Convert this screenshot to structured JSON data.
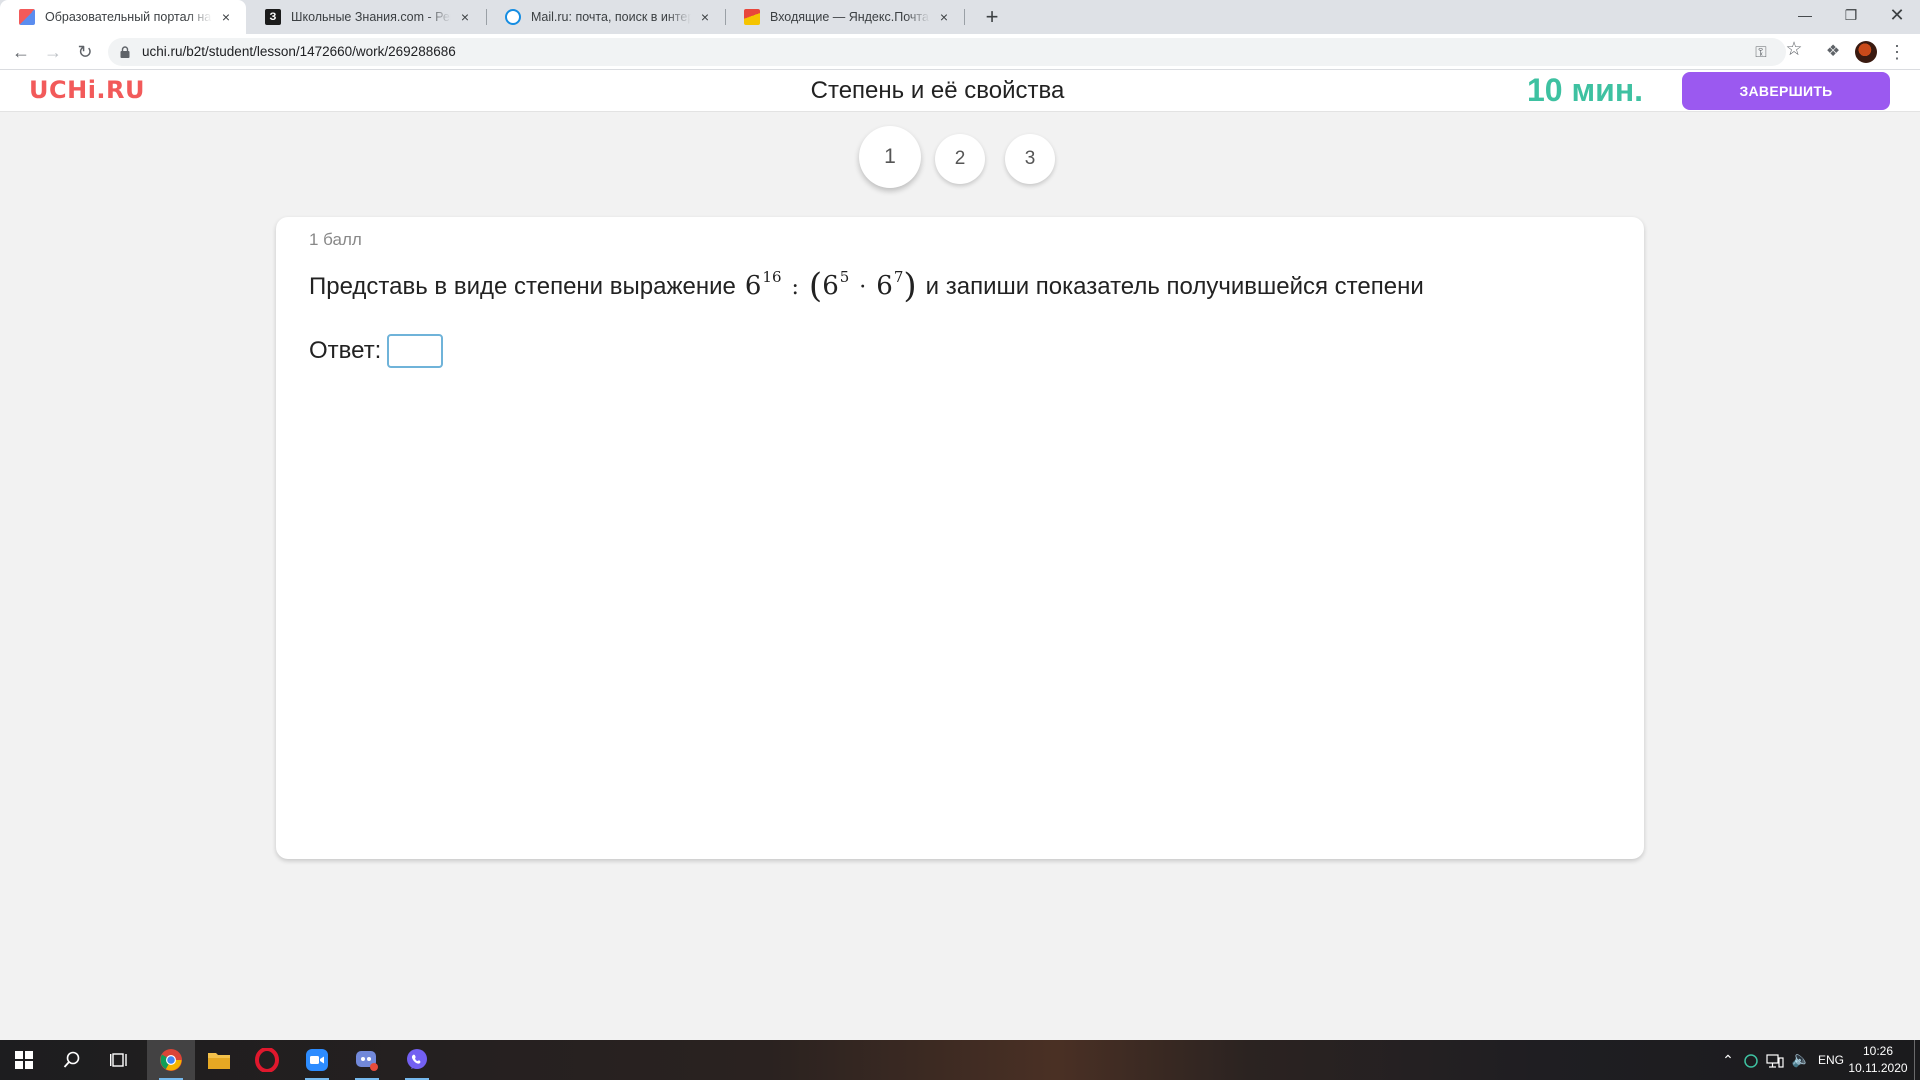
{
  "browser": {
    "tabs": [
      {
        "title": "Образовательный портал на базе",
        "active": true,
        "favicon_color": "#e86b5c"
      },
      {
        "title": "Школьные Знания.com - Решаем",
        "active": false,
        "favicon_color": "#1b1b1b"
      },
      {
        "title": "Mail.ru: почта, поиск в интернете",
        "active": false,
        "favicon_color": "#168de2"
      },
      {
        "title": "Входящие — Яндекс.Почта",
        "active": false,
        "favicon_color": "#f5c400"
      }
    ],
    "new_tab_label": "+",
    "close_glyph": "×",
    "url": "uchi.ru/b2t/student/lesson/1472660/work/269288686"
  },
  "site": {
    "logo": "UCHi.RU",
    "lesson_title": "Степень и её свойства",
    "timer": "10 мин.",
    "finish_button": "ЗАВЕРШИТЬ",
    "accent_colors": {
      "logo": "#f25a5a",
      "timer": "#3ec1a1",
      "button": "#9b59f0"
    }
  },
  "steps": [
    "1",
    "2",
    "3"
  ],
  "active_step": "1",
  "task": {
    "points": "1 балл",
    "question_before": "Представь в виде степени выражение",
    "math": {
      "base1": "6",
      "exp1": "16",
      "operator": ":",
      "open_paren": "(",
      "base2": "6",
      "exp2": "5",
      "dot": "·",
      "base3": "6",
      "exp3": "7",
      "close_paren": ")"
    },
    "question_after": "и запиши показатель получившейся степени",
    "answer_label": "Ответ:",
    "answer_value": ""
  },
  "taskbar": {
    "apps": [
      "windows-start",
      "search",
      "task-view",
      "chrome",
      "file-explorer",
      "opera",
      "zoom",
      "discord",
      "viber"
    ],
    "language": "ENG",
    "time": "10:26",
    "date": "10.11.2020"
  }
}
